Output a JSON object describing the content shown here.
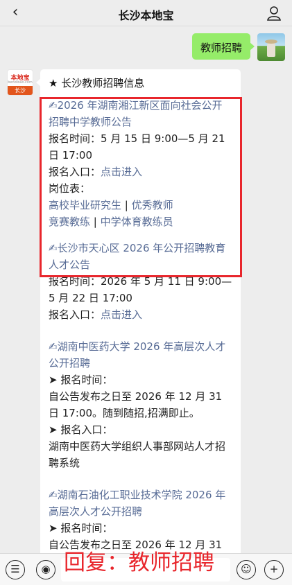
{
  "header": {
    "title": "长沙本地宝",
    "back_icon": "chevron-left-icon",
    "user_icon": "person-icon"
  },
  "outgoing": {
    "text": "教师招聘"
  },
  "bot_avatar": {
    "brand": "本地宝",
    "site": "bendibao.com",
    "city": "长沙"
  },
  "message": {
    "header": "★ 长沙教师招聘信息",
    "items": [
      {
        "title": "✍2026 年湖南湘江新区面向社会公开招聘中学教师公告",
        "time_label": "报名时间：",
        "time_value": "5 月 15 日 9:00—5 月 21 日 17:00",
        "entry_label": "报名入口：",
        "entry_link": "点击进入",
        "positions_label": "岗位表：",
        "position_1": "高校毕业研究生",
        "position_2": "优秀教师",
        "position_3": "竞赛教练",
        "position_4": "中学体育教练员",
        "separator": " | "
      },
      {
        "title": "✍长沙市天心区 2026 年公开招聘教育人才公告",
        "time_label": "报名时间：",
        "time_value": "2026 年 5 月 11 日 9:00—5 月 22 日 17:00",
        "entry_label": "报名入口：",
        "entry_link": "点击进入"
      },
      {
        "title": "✍湖南中医药大学 2026 年高层次人才公开招聘",
        "time_label": "➤ 报名时间：",
        "time_value": "自公告发布之日至 2026 年 12 月 31 日 17:00。随到随招,招满即止。",
        "entry_label": "➤ 报名入口：",
        "entry_value": "湖南中医药大学组织人事部网站人才招聘系统"
      },
      {
        "title": "✍湖南石油化工职业技术学院 2026 年高层次人才公开招聘",
        "time_label": "➤ 报名时间：",
        "time_value": "自公告发布之日至 2026 年 12 月 31 日"
      }
    ]
  },
  "bottom": {
    "voice_icon": "voice-icon",
    "emoji_icon": "emoji-icon",
    "plus_icon": "plus-icon",
    "overlay": "回复：教师招聘"
  },
  "colors": {
    "bubble_out": "#95ec69",
    "link": "#576b95",
    "highlight": "#e8262c"
  }
}
